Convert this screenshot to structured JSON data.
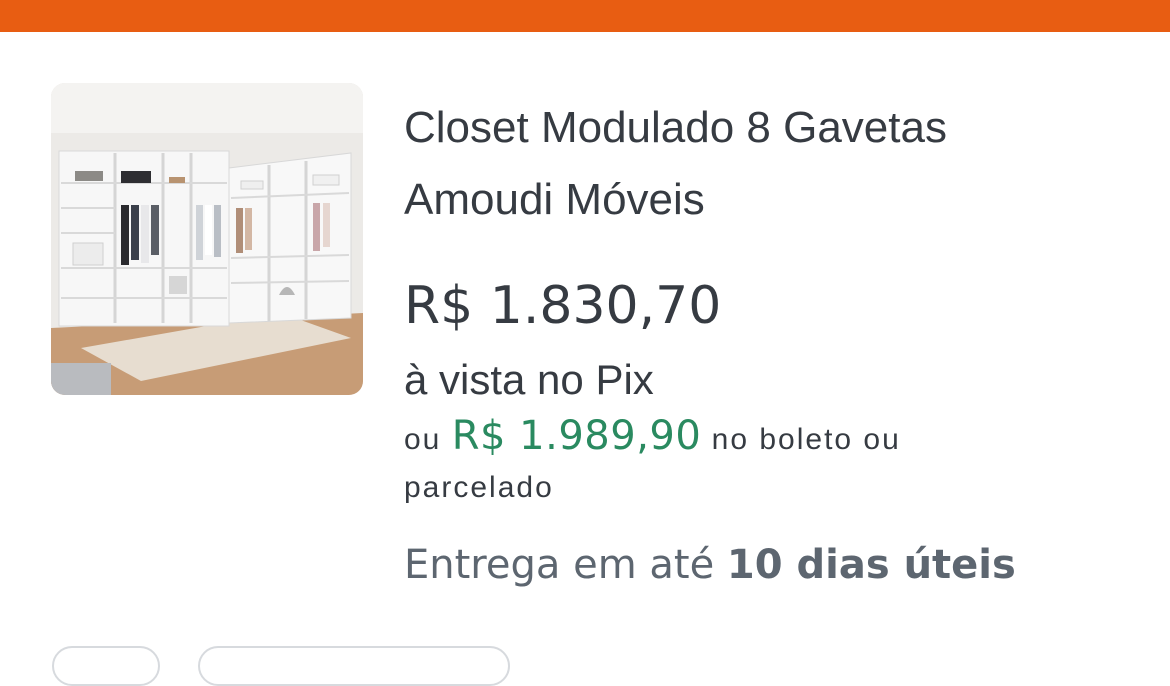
{
  "product": {
    "title_line1": "Closet Modulado 8 Gavetas",
    "title_line2": "Amoudi Móveis",
    "image_alt": "closet-product-photo",
    "price": "R$ 1.830,70",
    "price_note": "à vista no Pix",
    "alt_prefix": "ou",
    "alt_price": "R$ 1.989,90",
    "alt_suffix_line1": "no boleto ou",
    "alt_suffix_line2": "parcelado",
    "delivery_prefix": "Entrega em até",
    "delivery_days": "10 dias úteis"
  },
  "colors": {
    "accent": "#e85d12",
    "text": "#363b42",
    "alt_price": "#2a8a60",
    "delivery": "#5d6670"
  }
}
